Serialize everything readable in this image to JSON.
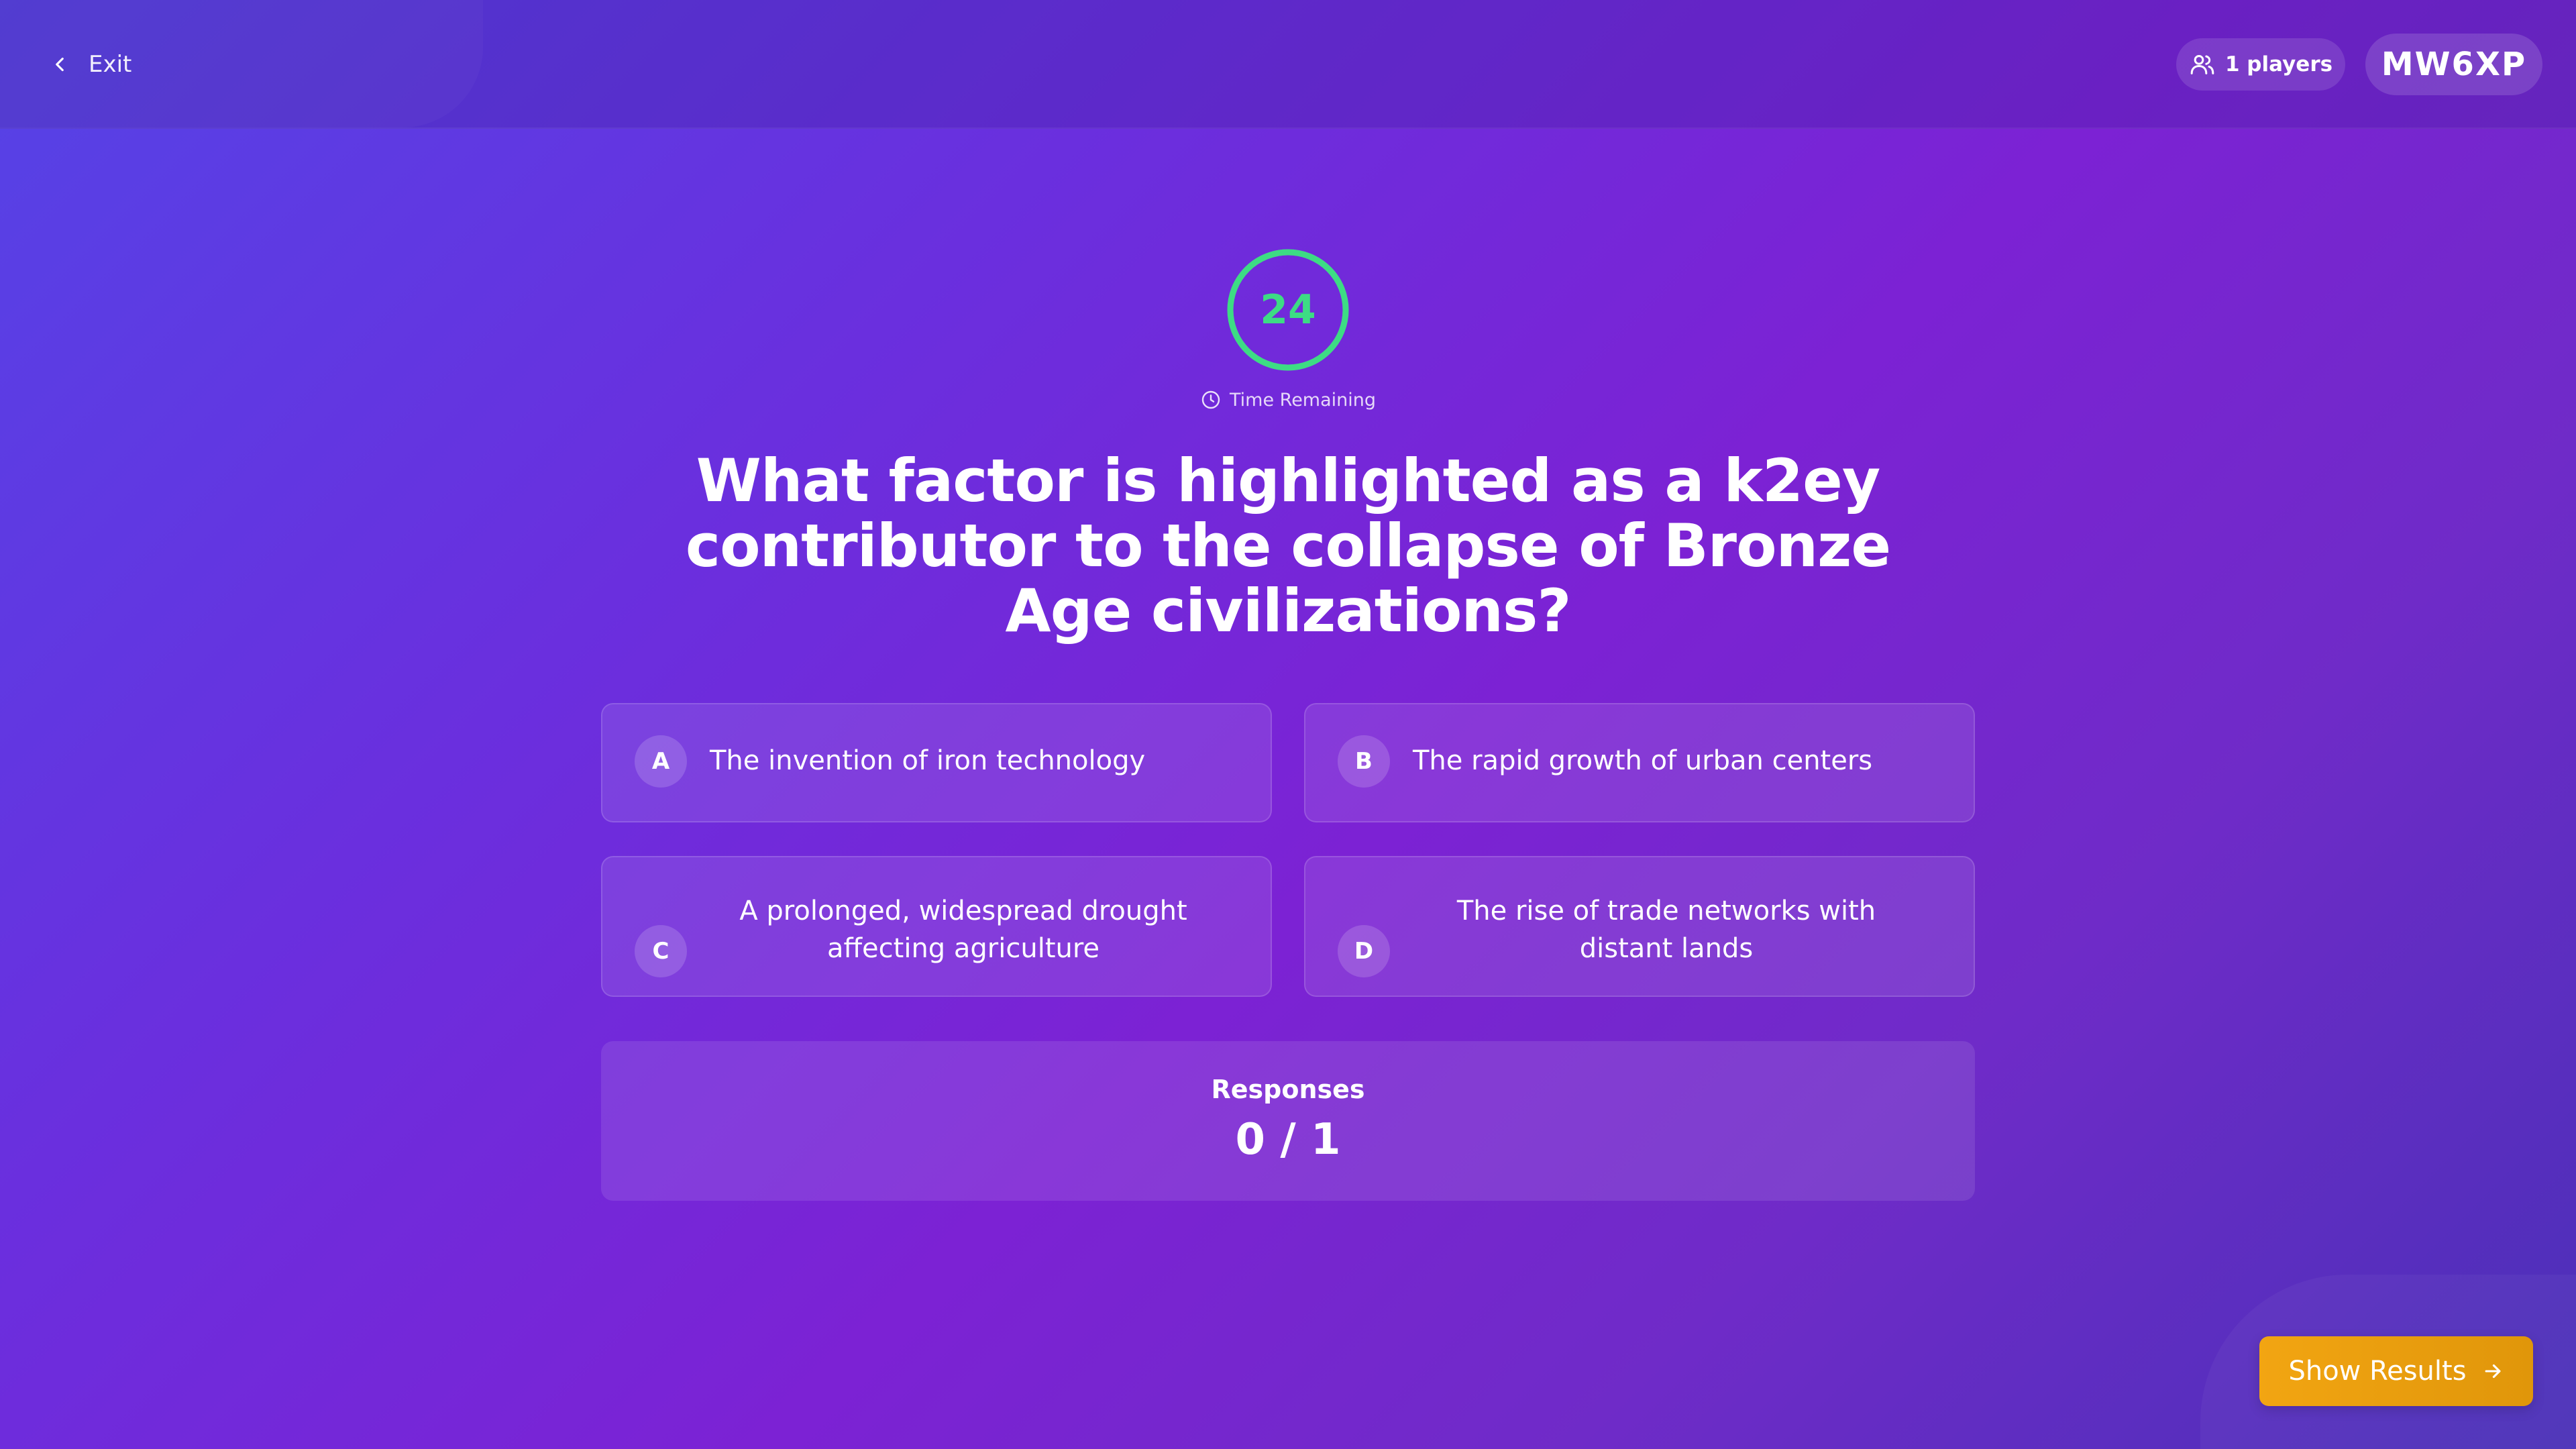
{
  "header": {
    "exit_label": "Exit",
    "players_label": "1 players",
    "game_code": "MW6XP"
  },
  "timer": {
    "seconds": "24",
    "label": "Time Remaining",
    "color": "#3ddc84"
  },
  "question": {
    "text": "What factor is highlighted as a k2ey contributor to the collapse of Bronze Age civilizations?"
  },
  "answers": [
    {
      "letter": "A",
      "text": "The invention of iron technology"
    },
    {
      "letter": "B",
      "text": "The rapid growth of urban centers"
    },
    {
      "letter": "C",
      "text": "A prolonged, widespread drought affecting agriculture"
    },
    {
      "letter": "D",
      "text": "The rise of trade networks with distant lands"
    }
  ],
  "responses": {
    "label": "Responses",
    "count": "0 / 1"
  },
  "actions": {
    "show_results_label": "Show Results",
    "accent_color": "#f2a512"
  },
  "icons": {
    "exit": "chevron-left-icon",
    "players": "users-icon",
    "timer": "clock-icon",
    "show_results": "arrow-right-icon"
  }
}
